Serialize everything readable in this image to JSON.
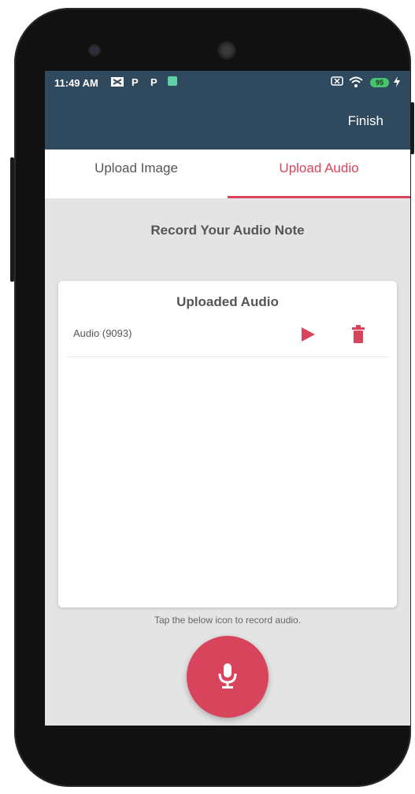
{
  "status_bar": {
    "time": "11:49 AM",
    "battery": "95",
    "icons": [
      "sync-icon",
      "p-icon",
      "p-icon",
      "app-icon",
      "sim-icon",
      "wifi-icon",
      "battery-icon",
      "charging-icon"
    ]
  },
  "app_bar": {
    "action_label": "Finish",
    "color": "#2f4a5f"
  },
  "tabs": [
    {
      "label": "Upload Image",
      "active": false
    },
    {
      "label": "Upload Audio",
      "active": true
    }
  ],
  "section_title": "Record Your Audio Note",
  "uploaded_card": {
    "title": "Uploaded Audio",
    "items": [
      {
        "name": "Audio (9093)",
        "actions": [
          "play-icon",
          "trash-icon"
        ]
      }
    ]
  },
  "hint_text": "Tap the below icon to record audio.",
  "colors": {
    "accent": "#d8445c",
    "header": "#2f4a5f",
    "background": "#e4e4e4"
  }
}
